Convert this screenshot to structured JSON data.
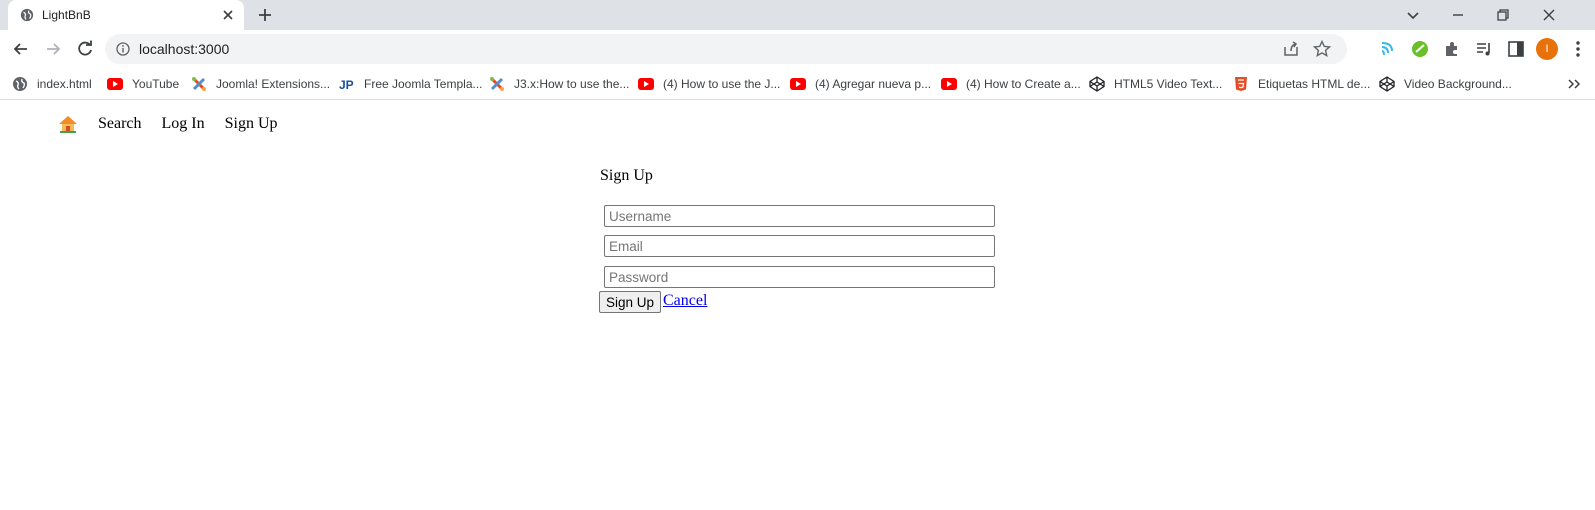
{
  "browser": {
    "tab": {
      "title": "LightBnB",
      "favicon": "globe-icon"
    },
    "address": "localhost:3000",
    "profile_initial": "I",
    "colors": {
      "tabstrip": "#dee1e6",
      "avatar": "#e8710a"
    }
  },
  "bookmarks": [
    {
      "label": "index.html",
      "icon": "globe-icon"
    },
    {
      "label": "YouTube",
      "icon": "youtube-icon"
    },
    {
      "label": "Joomla! Extensions...",
      "icon": "joomla-icon"
    },
    {
      "label": "Free Joomla Templa...",
      "icon": "jp-icon"
    },
    {
      "label": "J3.x:How to use the...",
      "icon": "joomla-icon"
    },
    {
      "label": "(4) How to use the J...",
      "icon": "youtube-icon"
    },
    {
      "label": "(4) Agregar nueva p...",
      "icon": "youtube-icon"
    },
    {
      "label": "(4) How to Create a...",
      "icon": "youtube-icon"
    },
    {
      "label": "HTML5 Video Text...",
      "icon": "codepen-icon"
    },
    {
      "label": "Etiquetas HTML de...",
      "icon": "html5-icon"
    },
    {
      "label": "Video Background...",
      "icon": "codepen-icon"
    }
  ],
  "site_nav": {
    "home_icon": "house-icon",
    "items": [
      "Search",
      "Log In",
      "Sign Up"
    ]
  },
  "signup_form": {
    "heading": "Sign Up",
    "username_placeholder": "Username",
    "email_placeholder": "Email",
    "password_placeholder": "Password",
    "submit_label": "Sign Up",
    "cancel_label": "Cancel"
  }
}
